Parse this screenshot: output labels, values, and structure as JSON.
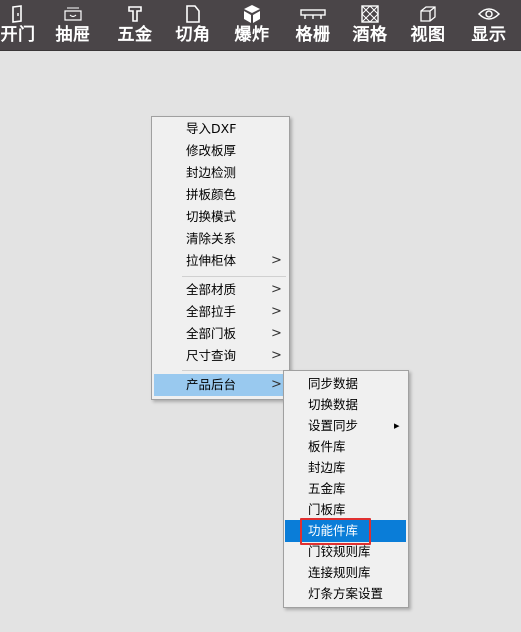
{
  "toolbar": {
    "items": [
      {
        "label": "开门",
        "icon": "door-icon"
      },
      {
        "label": "抽屉",
        "icon": "drawer-icon"
      },
      {
        "label": "五金",
        "icon": "hardware-icon"
      },
      {
        "label": "切角",
        "icon": "corner-cut-icon"
      },
      {
        "label": "爆炸",
        "icon": "explode-cube-icon"
      },
      {
        "label": "格栅",
        "icon": "grille-icon"
      },
      {
        "label": "酒格",
        "icon": "wine-rack-icon"
      },
      {
        "label": "视图",
        "icon": "view-cube-icon"
      },
      {
        "label": "显示",
        "icon": "eye-icon"
      }
    ]
  },
  "context_menu": {
    "items": [
      {
        "label": "导入DXF"
      },
      {
        "label": "修改板厚"
      },
      {
        "label": "封边检测"
      },
      {
        "label": "拼板颜色"
      },
      {
        "label": "切换模式"
      },
      {
        "label": "清除关系"
      },
      {
        "label": "拉伸柜体",
        "submenu": true
      },
      {
        "label": "全部材质",
        "submenu": true
      },
      {
        "label": "全部拉手",
        "submenu": true
      },
      {
        "label": "全部门板",
        "submenu": true
      },
      {
        "label": "尺寸查询",
        "submenu": true
      },
      {
        "label": "产品后台",
        "submenu": true,
        "highlighted": true
      }
    ],
    "arrow_glyph": ">"
  },
  "submenu": {
    "items": [
      {
        "label": "同步数据"
      },
      {
        "label": "切换数据"
      },
      {
        "label": "设置同步",
        "submenu": true
      },
      {
        "label": "板件库"
      },
      {
        "label": "封边库"
      },
      {
        "label": "五金库"
      },
      {
        "label": "门板库"
      },
      {
        "label": "功能件库",
        "selected": true
      },
      {
        "label": "门铰规则库"
      },
      {
        "label": "连接规则库"
      },
      {
        "label": "灯条方案设置"
      }
    ],
    "arrow_glyph": "▸"
  },
  "colors": {
    "toolbar_bg": "#4a4548",
    "background": "#e3e3e3",
    "menu_bg": "#f0f0f0",
    "hover_highlight": "#99c9ef",
    "selected_highlight": "#0a7dd8",
    "annotation_box": "#e03030"
  }
}
